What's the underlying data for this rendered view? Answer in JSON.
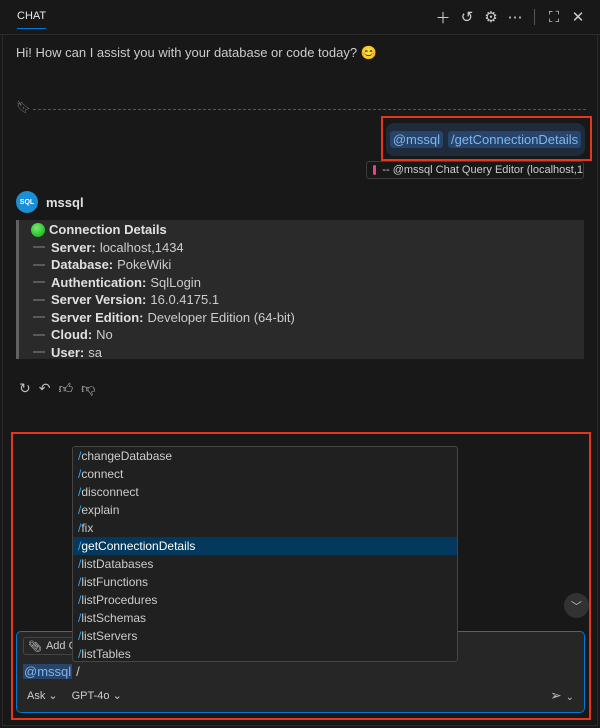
{
  "header": {
    "tab": "CHAT",
    "icons": [
      "plus-icon",
      "history-icon",
      "gear-icon",
      "more-icon",
      "maximize-icon",
      "close-icon"
    ]
  },
  "greeting": "Hi! How can I assist you with your database or code today? 😊",
  "request": {
    "agent": "@mssql",
    "command": "/getConnectionDetails",
    "reference": "-- @mssql Chat Query Editor (localhost,1"
  },
  "response": {
    "agent": "mssql",
    "avatar_text": "SQL",
    "title": "Connection Details",
    "rows": [
      {
        "label": "Server:",
        "value": "localhost,1434"
      },
      {
        "label": "Database:",
        "value": "PokeWiki"
      },
      {
        "label": "Authentication:",
        "value": "SqlLogin"
      },
      {
        "label": "Server Version:",
        "value": "16.0.4175.1"
      },
      {
        "label": "Server Edition:",
        "value": "Developer Edition (64-bit)"
      },
      {
        "label": "Cloud:",
        "value": "No"
      },
      {
        "label": "User:",
        "value": "sa"
      }
    ]
  },
  "suggestions": {
    "selected": "getConnectionDetails",
    "items": [
      "changeDatabase",
      "connect",
      "disconnect",
      "explain",
      "fix",
      "getConnectionDetails",
      "listDatabases",
      "listFunctions",
      "listProcedures",
      "listSchemas",
      "listServers",
      "listTables"
    ]
  },
  "input": {
    "add_context": "Add C",
    "agent": "@mssql",
    "text": "/",
    "mode": "Ask",
    "model": "GPT-4o"
  },
  "colors": {
    "accent": "#0078d4",
    "highlight": "#e5361e",
    "selection": "#04395e"
  }
}
